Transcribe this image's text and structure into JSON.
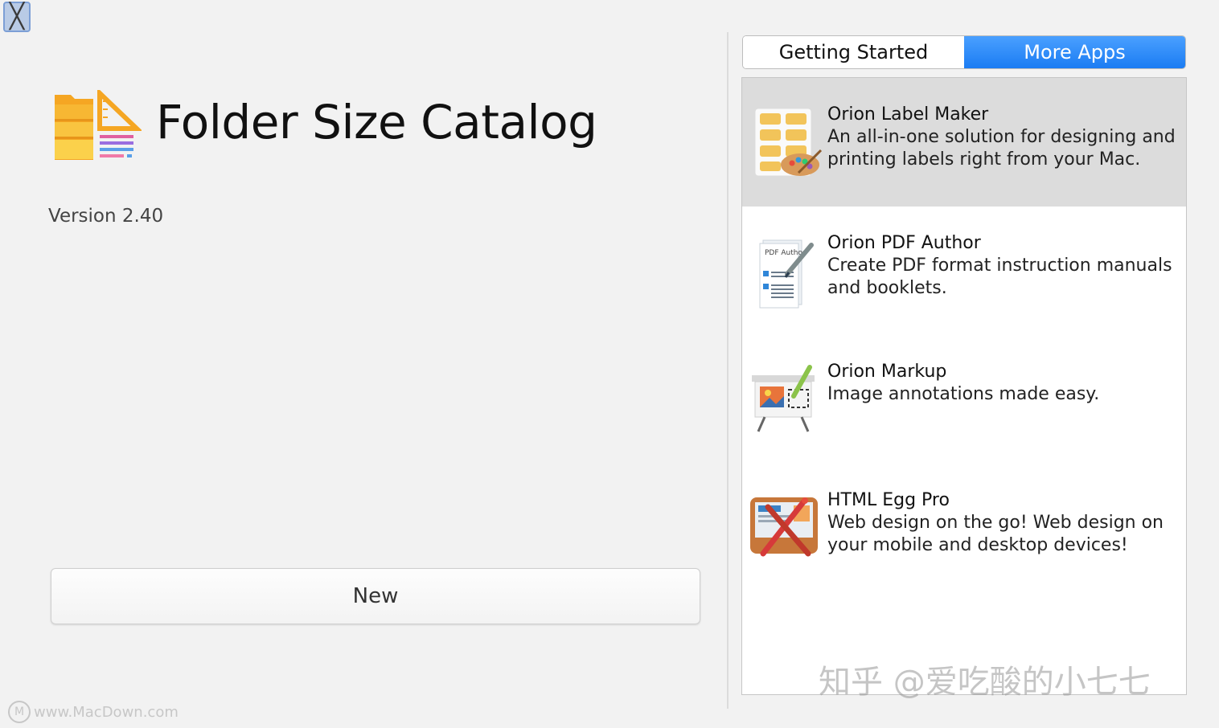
{
  "window": {
    "close_glyph": "╳"
  },
  "app": {
    "title": "Folder Size Catalog",
    "version": "Version 2.40",
    "icon": "folder-ruler-icon"
  },
  "buttons": {
    "new_label": "New"
  },
  "tabs": [
    {
      "label": "Getting Started",
      "active": false
    },
    {
      "label": "More Apps",
      "active": true
    }
  ],
  "more_apps": [
    {
      "name": "Orion Label Maker",
      "description": "An all-in-one solution for designing and printing labels right from your Mac.",
      "icon": "label-maker-icon",
      "selected": true
    },
    {
      "name": "Orion PDF Author",
      "description": "Create PDF format instruction manuals and booklets.",
      "icon": "pdf-author-icon",
      "icon_text": "PDF Author",
      "selected": false
    },
    {
      "name": "Orion Markup",
      "description": "Image annotations made easy.",
      "icon": "markup-easel-icon",
      "selected": false
    },
    {
      "name": "HTML Egg Pro",
      "description": "Web design on the go!  Web design on your mobile and desktop devices!",
      "icon": "html-egg-icon",
      "selected": false
    }
  ],
  "watermarks": {
    "zhihu": "知乎 @爱吃酸的小七七",
    "site": "www.MacDown.com",
    "site_logo": "M"
  },
  "colors": {
    "accent": "#1b7cf3",
    "selected_row": "#dcdcdc",
    "background": "#f2f2f2"
  }
}
